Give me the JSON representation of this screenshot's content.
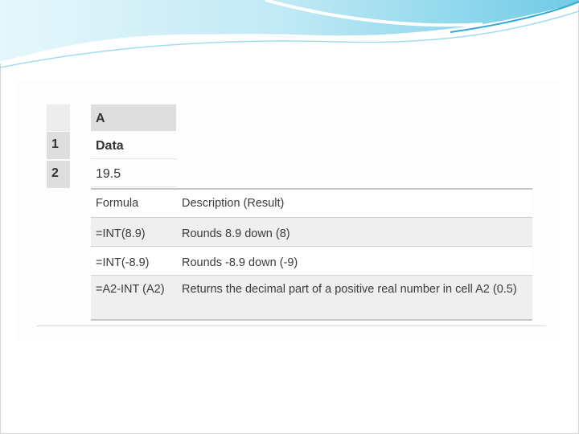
{
  "spreadsheet": {
    "column_header": "A",
    "rows": [
      {
        "number": "1",
        "value": "Data"
      },
      {
        "number": "2",
        "value": "19.5"
      }
    ]
  },
  "formula_table": {
    "headers": {
      "formula": "Formula",
      "description": "Description (Result)"
    },
    "rows": [
      {
        "formula": "=INT(8.9)",
        "description": "Rounds 8.9 down (8)"
      },
      {
        "formula": "=INT(-8.9)",
        "description": "Rounds -8.9 down (-9)"
      },
      {
        "formula": "=A2-INT (A2)",
        "description": "Returns the decimal part of a positive real number in cell A2 (0.5)"
      }
    ]
  },
  "colors": {
    "wave_light": "#c9eef7",
    "wave_accent": "#3fb6d8",
    "header_fill": "#dedede"
  }
}
